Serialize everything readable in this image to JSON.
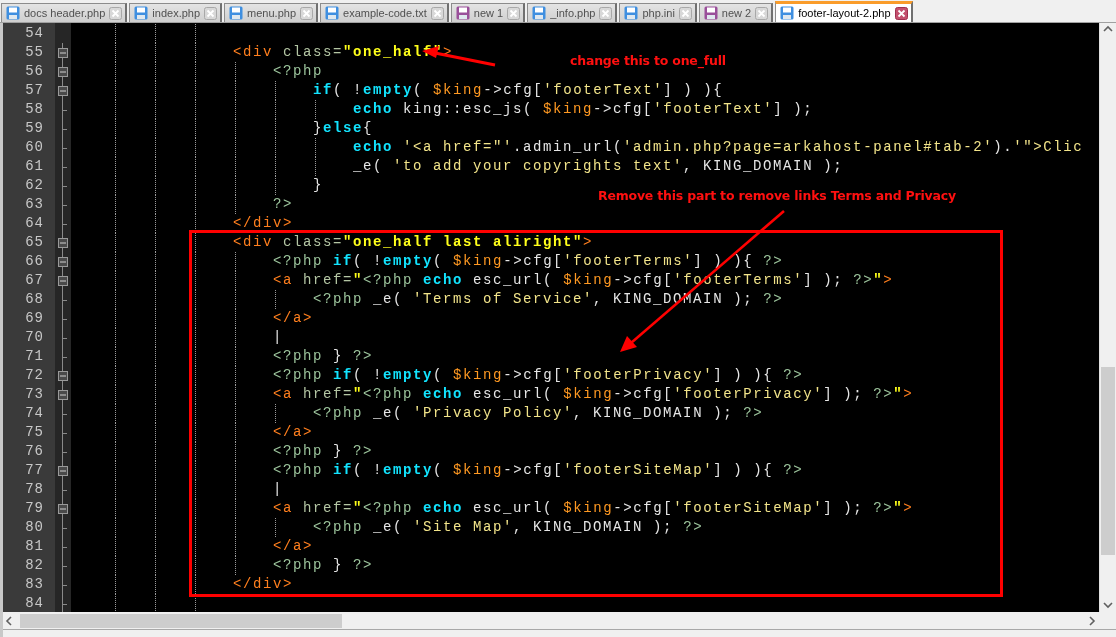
{
  "tabs": [
    {
      "label": "docs header.php",
      "color": "#3f8fe0",
      "selected": false
    },
    {
      "label": "index.php",
      "color": "#3f8fe0",
      "selected": false
    },
    {
      "label": "menu.php",
      "color": "#3f8fe0",
      "selected": false
    },
    {
      "label": "example-code.txt",
      "color": "#3f8fe0",
      "selected": false
    },
    {
      "label": "new 1",
      "color": "#9a4f9a",
      "selected": false
    },
    {
      "label": "_info.php",
      "color": "#3f8fe0",
      "selected": false
    },
    {
      "label": "php.ini",
      "color": "#3f8fe0",
      "selected": false
    },
    {
      "label": "new 2",
      "color": "#9a4f9a",
      "selected": false
    },
    {
      "label": "footer-layout-2.php",
      "color": "#3f8fe0",
      "selected": true
    }
  ],
  "editor": {
    "lines": [
      {
        "number": "54"
      },
      {
        "number": "55",
        "foldable": true,
        "tokens": [
          {
            "kind": "tag",
            "text": "                <div"
          },
          {
            "kind": "attr",
            "text": " class="
          },
          {
            "kind": "value",
            "text": "\"one_half\""
          },
          {
            "kind": "tag",
            "text": ">"
          }
        ]
      },
      {
        "number": "56",
        "foldable": true,
        "tokens": [
          {
            "kind": "php",
            "text": "                    <?php"
          }
        ]
      },
      {
        "number": "57",
        "foldable": true,
        "tokens": [
          {
            "kind": "keyword",
            "text": "                        if"
          },
          {
            "kind": "plain",
            "text": "( !"
          },
          {
            "kind": "keyword",
            "text": "empty"
          },
          {
            "kind": "plain",
            "text": "( "
          },
          {
            "kind": "variable",
            "text": "$king"
          },
          {
            "kind": "plain",
            "text": "->cfg["
          },
          {
            "kind": "string",
            "text": "'footerText'"
          },
          {
            "kind": "plain",
            "text": "] ) ){"
          }
        ]
      },
      {
        "number": "58",
        "foldable": false,
        "tokens": [
          {
            "kind": "keyword",
            "text": "                            echo"
          },
          {
            "kind": "plain",
            "text": " king::esc_js( "
          },
          {
            "kind": "variable",
            "text": "$king"
          },
          {
            "kind": "plain",
            "text": "->cfg["
          },
          {
            "kind": "string",
            "text": "'footerText'"
          },
          {
            "kind": "plain",
            "text": "] );"
          }
        ]
      },
      {
        "number": "59",
        "foldable": false,
        "tokens": [
          {
            "kind": "plain",
            "text": "                        }"
          },
          {
            "kind": "keyword",
            "text": "else"
          },
          {
            "kind": "plain",
            "text": "{"
          }
        ]
      },
      {
        "number": "60",
        "foldable": false,
        "tokens": [
          {
            "kind": "keyword",
            "text": "                            echo "
          },
          {
            "kind": "string",
            "text": "'<a href=\"'"
          },
          {
            "kind": "plain",
            "text": ".admin_url("
          },
          {
            "kind": "string",
            "text": "'admin.php?page=arkahost-panel#tab-2'"
          },
          {
            "kind": "plain",
            "text": ")."
          },
          {
            "kind": "string",
            "text": "'\">Clic"
          }
        ]
      },
      {
        "number": "61",
        "foldable": false,
        "tokens": [
          {
            "kind": "plain",
            "text": "                            _e( "
          },
          {
            "kind": "string",
            "text": "'to add your copyrights text'"
          },
          {
            "kind": "plain",
            "text": ", KING_DOMAIN );"
          }
        ]
      },
      {
        "number": "62",
        "foldable": false,
        "tokens": [
          {
            "kind": "plain",
            "text": "                        }"
          }
        ]
      },
      {
        "number": "63",
        "foldable": false,
        "tokens": [
          {
            "kind": "php",
            "text": "                    ?>"
          }
        ]
      },
      {
        "number": "64",
        "foldable": false,
        "tokens": [
          {
            "kind": "tag",
            "text": "                </div>"
          }
        ]
      },
      {
        "number": "65",
        "foldable": true,
        "tokens": [
          {
            "kind": "tag",
            "text": "                <div"
          },
          {
            "kind": "attr",
            "text": " class="
          },
          {
            "kind": "value",
            "text": "\"one_half last aliright\""
          },
          {
            "kind": "tag",
            "text": ">"
          }
        ]
      },
      {
        "number": "66",
        "foldable": true,
        "tokens": [
          {
            "kind": "php",
            "text": "                    <?php "
          },
          {
            "kind": "keyword",
            "text": "if"
          },
          {
            "kind": "plain",
            "text": "( !"
          },
          {
            "kind": "keyword",
            "text": "empty"
          },
          {
            "kind": "plain",
            "text": "( "
          },
          {
            "kind": "variable",
            "text": "$king"
          },
          {
            "kind": "plain",
            "text": "->cfg["
          },
          {
            "kind": "string",
            "text": "'footerTerms'"
          },
          {
            "kind": "plain",
            "text": "] ) ){ "
          },
          {
            "kind": "php",
            "text": "?>"
          }
        ]
      },
      {
        "number": "67",
        "foldable": true,
        "tokens": [
          {
            "kind": "tag",
            "text": "                    <a"
          },
          {
            "kind": "attr",
            "text": " href="
          },
          {
            "kind": "value",
            "text": "\""
          },
          {
            "kind": "php",
            "text": "<?php "
          },
          {
            "kind": "keyword",
            "text": "echo"
          },
          {
            "kind": "plain",
            "text": " esc_url( "
          },
          {
            "kind": "variable",
            "text": "$king"
          },
          {
            "kind": "plain",
            "text": "->cfg["
          },
          {
            "kind": "string",
            "text": "'footerTerms'"
          },
          {
            "kind": "plain",
            "text": "] ); "
          },
          {
            "kind": "php",
            "text": "?>"
          },
          {
            "kind": "value",
            "text": "\""
          },
          {
            "kind": "tag",
            "text": ">"
          }
        ]
      },
      {
        "number": "68",
        "foldable": false,
        "tokens": [
          {
            "kind": "php",
            "text": "                        <?php "
          },
          {
            "kind": "plain",
            "text": "_e( "
          },
          {
            "kind": "string",
            "text": "'Terms of Service'"
          },
          {
            "kind": "plain",
            "text": ", KING_DOMAIN ); "
          },
          {
            "kind": "php",
            "text": "?>"
          }
        ]
      },
      {
        "number": "69",
        "foldable": false,
        "tokens": [
          {
            "kind": "tag",
            "text": "                    </a>"
          }
        ]
      },
      {
        "number": "70",
        "foldable": false,
        "tokens": [
          {
            "kind": "plain",
            "text": "                    |"
          }
        ]
      },
      {
        "number": "71",
        "foldable": false,
        "tokens": [
          {
            "kind": "php",
            "text": "                    <?php "
          },
          {
            "kind": "plain",
            "text": "} "
          },
          {
            "kind": "php",
            "text": "?>"
          }
        ]
      },
      {
        "number": "72",
        "foldable": true,
        "tokens": [
          {
            "kind": "php",
            "text": "                    <?php "
          },
          {
            "kind": "keyword",
            "text": "if"
          },
          {
            "kind": "plain",
            "text": "( !"
          },
          {
            "kind": "keyword",
            "text": "empty"
          },
          {
            "kind": "plain",
            "text": "( "
          },
          {
            "kind": "variable",
            "text": "$king"
          },
          {
            "kind": "plain",
            "text": "->cfg["
          },
          {
            "kind": "string",
            "text": "'footerPrivacy'"
          },
          {
            "kind": "plain",
            "text": "] ) ){ "
          },
          {
            "kind": "php",
            "text": "?>"
          }
        ]
      },
      {
        "number": "73",
        "foldable": true,
        "tokens": [
          {
            "kind": "tag",
            "text": "                    <a"
          },
          {
            "kind": "attr",
            "text": " href="
          },
          {
            "kind": "value",
            "text": "\""
          },
          {
            "kind": "php",
            "text": "<?php "
          },
          {
            "kind": "keyword",
            "text": "echo"
          },
          {
            "kind": "plain",
            "text": " esc_url( "
          },
          {
            "kind": "variable",
            "text": "$king"
          },
          {
            "kind": "plain",
            "text": "->cfg["
          },
          {
            "kind": "string",
            "text": "'footerPrivacy'"
          },
          {
            "kind": "plain",
            "text": "] ); "
          },
          {
            "kind": "php",
            "text": "?>"
          },
          {
            "kind": "value",
            "text": "\""
          },
          {
            "kind": "tag",
            "text": ">"
          }
        ]
      },
      {
        "number": "74",
        "foldable": false,
        "tokens": [
          {
            "kind": "php",
            "text": "                        <?php "
          },
          {
            "kind": "plain",
            "text": "_e( "
          },
          {
            "kind": "string",
            "text": "'Privacy Policy'"
          },
          {
            "kind": "plain",
            "text": ", KING_DOMAIN ); "
          },
          {
            "kind": "php",
            "text": "?>"
          }
        ]
      },
      {
        "number": "75",
        "foldable": false,
        "tokens": [
          {
            "kind": "tag",
            "text": "                    </a>"
          }
        ]
      },
      {
        "number": "76",
        "foldable": false,
        "tokens": [
          {
            "kind": "php",
            "text": "                    <?php "
          },
          {
            "kind": "plain",
            "text": "} "
          },
          {
            "kind": "php",
            "text": "?>"
          }
        ]
      },
      {
        "number": "77",
        "foldable": true,
        "tokens": [
          {
            "kind": "php",
            "text": "                    <?php "
          },
          {
            "kind": "keyword",
            "text": "if"
          },
          {
            "kind": "plain",
            "text": "( !"
          },
          {
            "kind": "keyword",
            "text": "empty"
          },
          {
            "kind": "plain",
            "text": "( "
          },
          {
            "kind": "variable",
            "text": "$king"
          },
          {
            "kind": "plain",
            "text": "->cfg["
          },
          {
            "kind": "string",
            "text": "'footerSiteMap'"
          },
          {
            "kind": "plain",
            "text": "] ) ){ "
          },
          {
            "kind": "php",
            "text": "?>"
          }
        ]
      },
      {
        "number": "78",
        "foldable": false,
        "tokens": [
          {
            "kind": "plain",
            "text": "                    |"
          }
        ]
      },
      {
        "number": "79",
        "foldable": true,
        "tokens": [
          {
            "kind": "tag",
            "text": "                    <a"
          },
          {
            "kind": "attr",
            "text": " href="
          },
          {
            "kind": "value",
            "text": "\""
          },
          {
            "kind": "php",
            "text": "<?php "
          },
          {
            "kind": "keyword",
            "text": "echo"
          },
          {
            "kind": "plain",
            "text": " esc_url( "
          },
          {
            "kind": "variable",
            "text": "$king"
          },
          {
            "kind": "plain",
            "text": "->cfg["
          },
          {
            "kind": "string",
            "text": "'footerSiteMap'"
          },
          {
            "kind": "plain",
            "text": "] ); "
          },
          {
            "kind": "php",
            "text": "?>"
          },
          {
            "kind": "value",
            "text": "\""
          },
          {
            "kind": "tag",
            "text": ">"
          }
        ]
      },
      {
        "number": "80",
        "foldable": false,
        "tokens": [
          {
            "kind": "php",
            "text": "                        <?php "
          },
          {
            "kind": "plain",
            "text": "_e( "
          },
          {
            "kind": "string",
            "text": "'Site Map'"
          },
          {
            "kind": "plain",
            "text": ", KING_DOMAIN ); "
          },
          {
            "kind": "php",
            "text": "?>"
          }
        ]
      },
      {
        "number": "81",
        "foldable": false,
        "tokens": [
          {
            "kind": "tag",
            "text": "                    </a>"
          }
        ]
      },
      {
        "number": "82",
        "foldable": false,
        "tokens": [
          {
            "kind": "php",
            "text": "                    <?php "
          },
          {
            "kind": "plain",
            "text": "} "
          },
          {
            "kind": "php",
            "text": "?>"
          }
        ]
      },
      {
        "number": "83",
        "foldable": false,
        "tokens": [
          {
            "kind": "tag",
            "text": "                </div>"
          }
        ]
      },
      {
        "number": "84",
        "foldable": false
      }
    ]
  },
  "annotations": [
    {
      "kind": "note",
      "text": "change this to one_full"
    },
    {
      "kind": "note",
      "text": "Remove this part to remove links Terms and Privacy"
    }
  ]
}
